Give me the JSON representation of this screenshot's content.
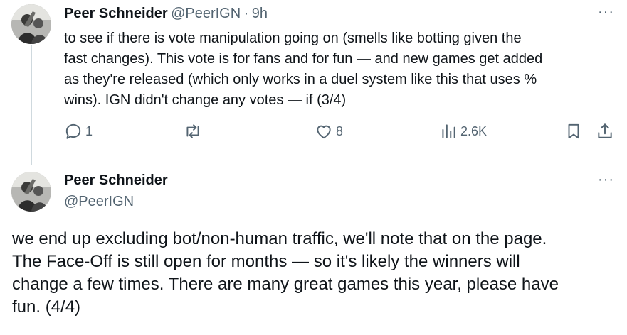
{
  "tweet1": {
    "author_name": "Peer Schneider",
    "handle": "@PeerIGN",
    "separator": "·",
    "time": "9h",
    "more": "···",
    "lines": [
      "to see if there is vote manipulation going on (smells like botting given the",
      "fast changes). This vote is for fans and for fun — and new games get added",
      "as they're released (which only works in a duel system like this that uses %",
      "wins).  IGN didn't change any votes — if (3/4)"
    ],
    "actions": {
      "reply_icon": "reply-icon",
      "reply_count": "1",
      "retweet_icon": "retweet-icon",
      "like_icon": "heart-icon",
      "like_count": "8",
      "views_icon": "views-icon",
      "views_count": "2.6K",
      "bookmark_icon": "bookmark-icon",
      "share_icon": "share-icon"
    }
  },
  "tweet2": {
    "author_name": "Peer Schneider",
    "handle": "@PeerIGN",
    "more": "···",
    "lines": [
      "we end up excluding bot/non-human traffic, we'll note that on the page.",
      "The Face-Off is still open for months — so it's likely the winners will",
      "change a few times. There are many great games this year, please have",
      "fun. (4/4)"
    ]
  },
  "colors": {
    "text": "#0f1419",
    "muted": "#536471",
    "thread_line": "#cfd9de",
    "background": "#ffffff"
  }
}
